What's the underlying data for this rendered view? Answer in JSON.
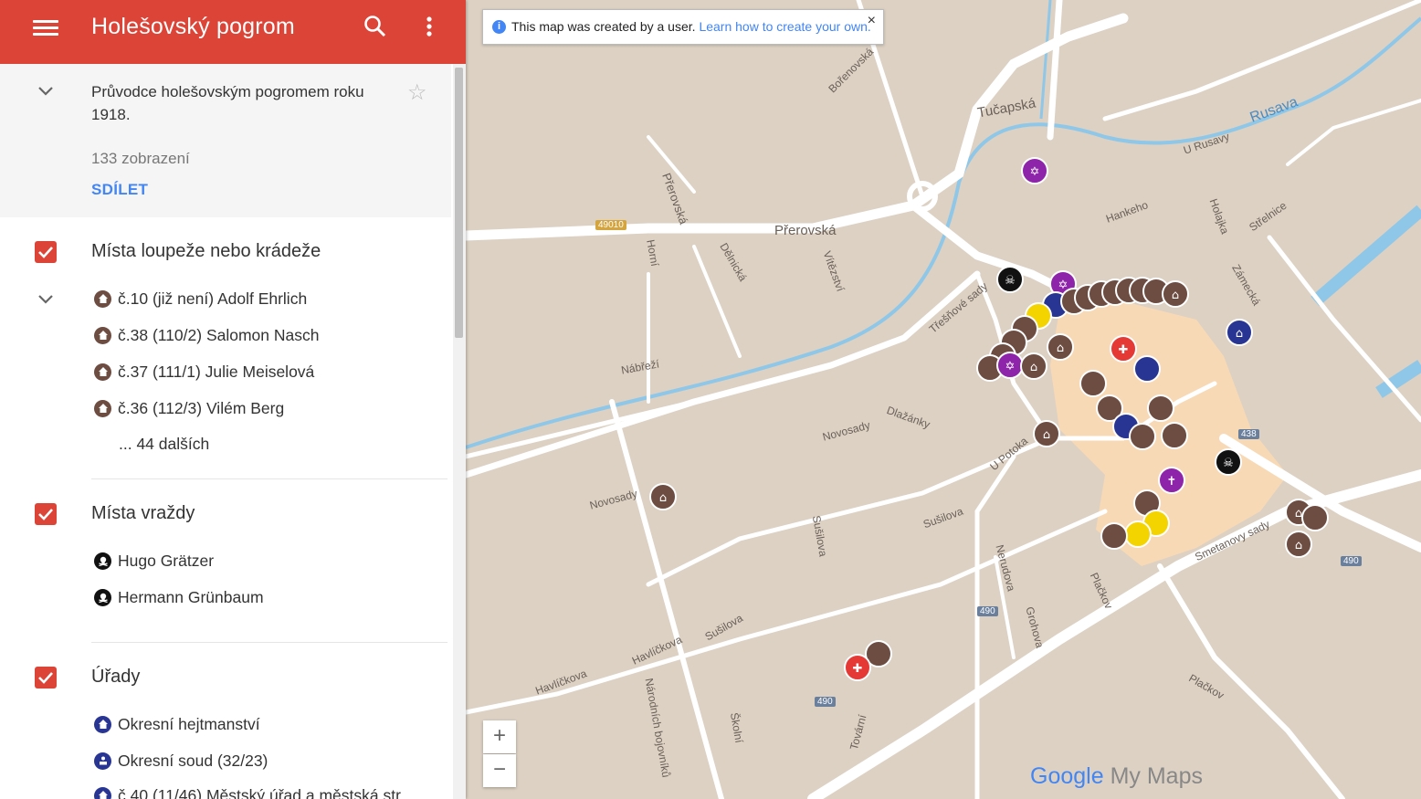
{
  "header": {
    "menu_icon": "menu-icon",
    "title": "Holešovský pogrom",
    "search_icon": "search-icon",
    "more_icon": "more-vert-icon"
  },
  "description": {
    "text": "Průvodce holešovským pogromem roku 1918.",
    "views": "133 zobrazení",
    "share_label": "SDÍLET"
  },
  "layers": [
    {
      "title": "Místa loupeže nebo krádeže",
      "checked": true,
      "items": [
        "č.10 (již není) Adolf Ehrlich",
        "č.38 (110/2) Salomon Nasch",
        "č.37 (111/1) Julie Meiselová",
        "č.36 (112/3) Vilém Berg"
      ],
      "more": "... 44 dalších"
    },
    {
      "title": "Místa vraždy",
      "checked": true,
      "items": [
        "Hugo Grätzer",
        "Hermann Grünbaum"
      ]
    },
    {
      "title": "Úřady",
      "checked": true,
      "items": [
        "Okresní hejtmanství",
        "Okresní soud (32/23)",
        "č.40 (11/46) Městský úřad a městská str..."
      ]
    }
  ],
  "banner": {
    "text": "This map was created by a user.",
    "link": "Learn how to create your own.",
    "close": "×"
  },
  "zoom": {
    "in": "+",
    "out": "−"
  },
  "logo": {
    "google": "Google",
    "product": "My Maps"
  },
  "map_labels": {
    "tucapska": "Tučapská",
    "rusava": "Rusava",
    "u_rusavy": "U Rusavy",
    "borenovska": "Bořenovská",
    "prerovska_top": "Přerovská",
    "prerovska_main": "Přerovská",
    "road_49010": "49010",
    "hankeho": "Hankeho",
    "holajka": "Holajka",
    "strelnice": "Střelnice",
    "horni": "Horní",
    "delnicka": "Dělnická",
    "vitezstvi": "Vítězství",
    "nabrezi": "Nábřeží",
    "novosady": "Novosady",
    "dlazanky": "Dlažánky",
    "u_potoka": "U Potoka",
    "susilova": "Sušilova",
    "nerudova": "Nerudova",
    "grohova": "Grohova",
    "plackov": "Plačkov",
    "havlickova": "Havlíčkova",
    "narodnich_bojovniku": "Národních bojovníků",
    "skolni": "Školní",
    "tovarni": "Tovární",
    "zamecka": "Zámecká",
    "smetanovy_sady": "Smetanovy sady",
    "tresnove_sady": "Třešňové sady",
    "road_490": "490",
    "road_438": "438"
  },
  "colors": {
    "header": "#db4437",
    "link": "#4285f4",
    "marker_brown": "#6d4c41",
    "marker_purple": "#8e24aa",
    "marker_black": "#111111",
    "marker_navy": "#283593",
    "marker_yellow": "#f4d400",
    "marker_red": "#e53935"
  }
}
